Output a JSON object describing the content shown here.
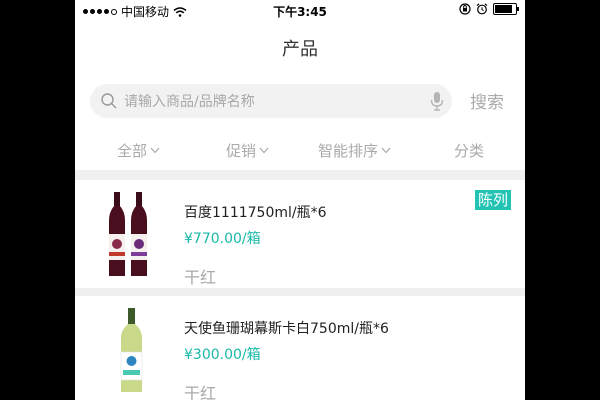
{
  "status_bar": {
    "carrier": "中国移动",
    "time": "下午3:45"
  },
  "header": {
    "title": "产品"
  },
  "search": {
    "placeholder": "请输入商品/品牌名称",
    "button_label": "搜索"
  },
  "filters": [
    {
      "label": "全部",
      "has_dropdown": true
    },
    {
      "label": "促销",
      "has_dropdown": true
    },
    {
      "label": "智能排序",
      "has_dropdown": true
    },
    {
      "label": "分类",
      "has_dropdown": false
    }
  ],
  "products": [
    {
      "name": "百度1111750ml/瓶*6",
      "price": "¥770.00/箱",
      "category": "干红",
      "tag": "陈列"
    },
    {
      "name": "天使鱼珊瑚幕斯卡白750ml/瓶*6",
      "price": "¥300.00/箱",
      "category": "干红"
    }
  ],
  "colors": {
    "accent": "#22c3b3",
    "price": "#18b9a8",
    "muted": "#aaaaaa"
  }
}
